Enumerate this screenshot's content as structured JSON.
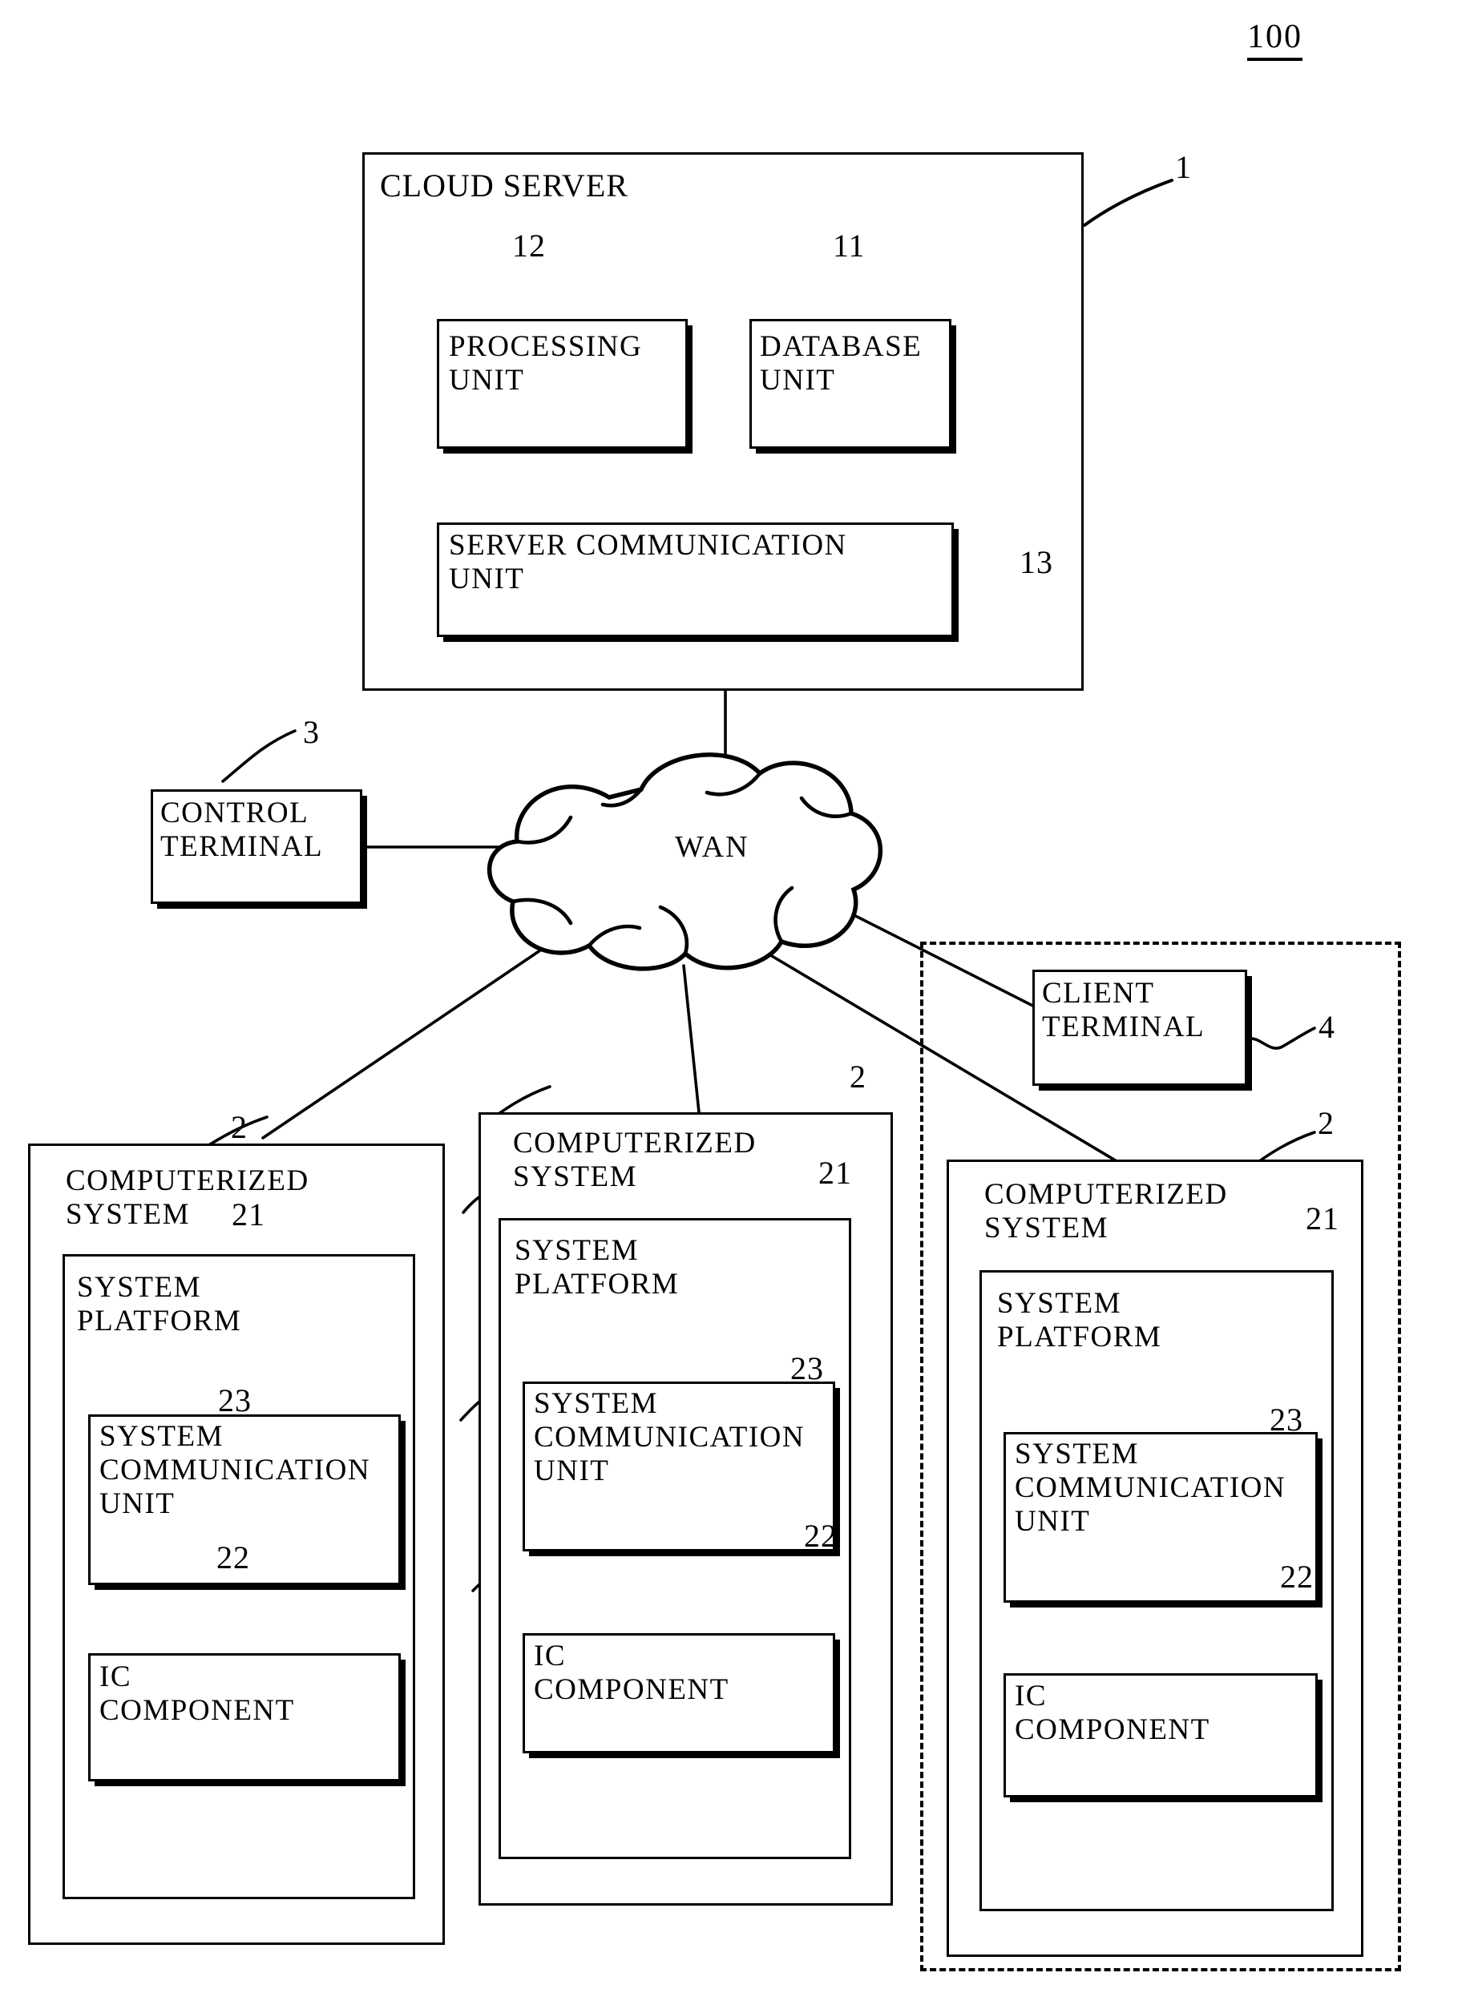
{
  "figure": {
    "number": "100"
  },
  "cloud_server": {
    "title": "CLOUD SERVER",
    "ref": "1",
    "processing_unit": {
      "label": "PROCESSING\nUNIT",
      "ref": "12"
    },
    "database_unit": {
      "label": "DATABASE\nUNIT",
      "ref": "11"
    },
    "server_comm_unit": {
      "label": "SERVER COMMUNICATION\nUNIT",
      "ref": "13"
    }
  },
  "network": {
    "cloud_label": "WAN"
  },
  "control_terminal": {
    "label": "CONTROL\nTERMINAL",
    "ref": "3"
  },
  "client_terminal": {
    "label": "CLIENT\nTERMINAL",
    "ref": "4"
  },
  "computerized_systems": [
    {
      "title": "COMPUTERIZED\nSYSTEM",
      "ref": "2",
      "platform": {
        "label": "SYSTEM\nPLATFORM",
        "ref": "21"
      },
      "comm_unit": {
        "label": "SYSTEM\nCOMMUNICATION\nUNIT",
        "ref": "23"
      },
      "ic_component": {
        "label": "IC\nCOMPONENT",
        "ref": "22"
      }
    },
    {
      "title": "COMPUTERIZED\nSYSTEM",
      "ref": "2",
      "platform": {
        "label": "SYSTEM\nPLATFORM",
        "ref": "21"
      },
      "comm_unit": {
        "label": "SYSTEM\nCOMMUNICATION\nUNIT",
        "ref": "23"
      },
      "ic_component": {
        "label": "IC\nCOMPONENT",
        "ref": "22"
      }
    },
    {
      "title": "COMPUTERIZED\nSYSTEM",
      "ref": "2",
      "platform": {
        "label": "SYSTEM\nPLATFORM",
        "ref": "21"
      },
      "comm_unit": {
        "label": "SYSTEM\nCOMMUNICATION\nUNIT",
        "ref": "23"
      },
      "ic_component": {
        "label": "IC\nCOMPONENT",
        "ref": "22"
      }
    }
  ],
  "colors": {
    "stroke": "#000000",
    "background": "#ffffff"
  }
}
